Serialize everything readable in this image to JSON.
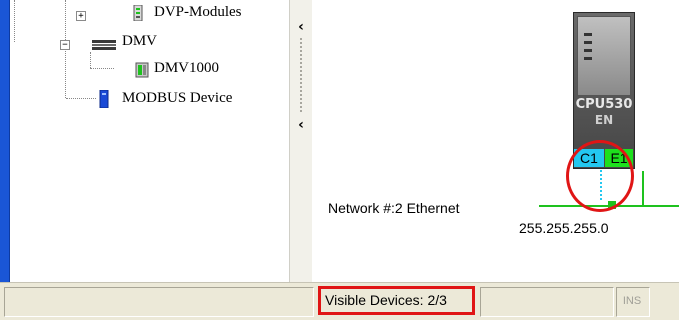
{
  "tree": {
    "items": [
      {
        "label": "DVP-Modules",
        "expander": "+",
        "icon": "module-icon"
      },
      {
        "label": "DMV",
        "expander": "−",
        "icon": "dmv-folder-icon"
      },
      {
        "label": "DMV1000",
        "icon": "dmv-device-icon"
      },
      {
        "label": "MODBUS Device",
        "icon": "modbus-device-icon"
      }
    ]
  },
  "splitter": {
    "collapse_glyph_top": "‹",
    "collapse_glyph_bottom": "‹"
  },
  "canvas": {
    "network_label": "Network #:2  Ethernet",
    "netmask": "255.255.255.0",
    "cpu": {
      "name": "CPU530",
      "sub": "EN",
      "ports": [
        "C1",
        "E1"
      ]
    }
  },
  "statusbar": {
    "visible_devices": "Visible Devices: 2/3",
    "mode": "INS"
  },
  "colors": {
    "accent_blue": "#1a56d6",
    "network_green": "#1ec21e",
    "port_cyan": "#23c8f0",
    "highlight_red": "#e01515"
  }
}
